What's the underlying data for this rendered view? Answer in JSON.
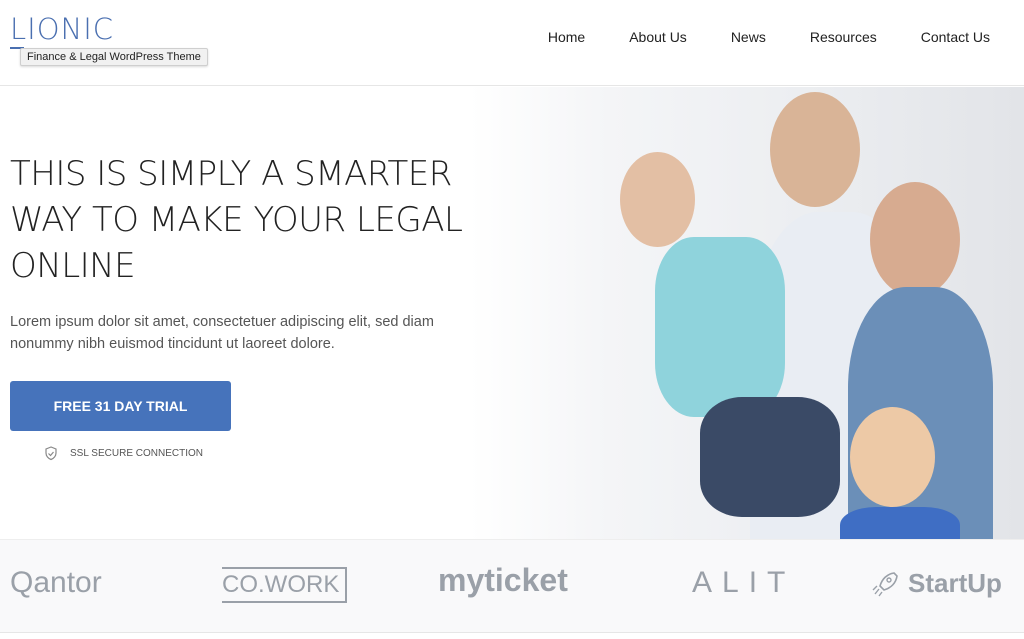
{
  "header": {
    "logo": "LIONIC",
    "tooltip": "Finance & Legal WordPress Theme",
    "nav": [
      "Home",
      "About Us",
      "News",
      "Resources",
      "Contact Us"
    ]
  },
  "hero": {
    "title": "THIS IS SIMPLY A SMARTER WAY TO MAKE YOUR LEGAL ONLINE",
    "description": "Lorem ipsum dolor sit amet, consectetuer adipiscing elit, sed diam nonummy nibh euismod tincidunt ut laoreet dolore.",
    "cta_label": "FREE 31 DAY TRIAL",
    "ssl_label": "SSL SECURE CONNECTION",
    "accent": "#4673bb"
  },
  "partners": [
    "Qantor",
    "CO.WORK",
    "myticket",
    "ALIT",
    "StartUp"
  ],
  "icons": {
    "ssl": "shield-check-icon",
    "startup": "rocket-icon"
  }
}
